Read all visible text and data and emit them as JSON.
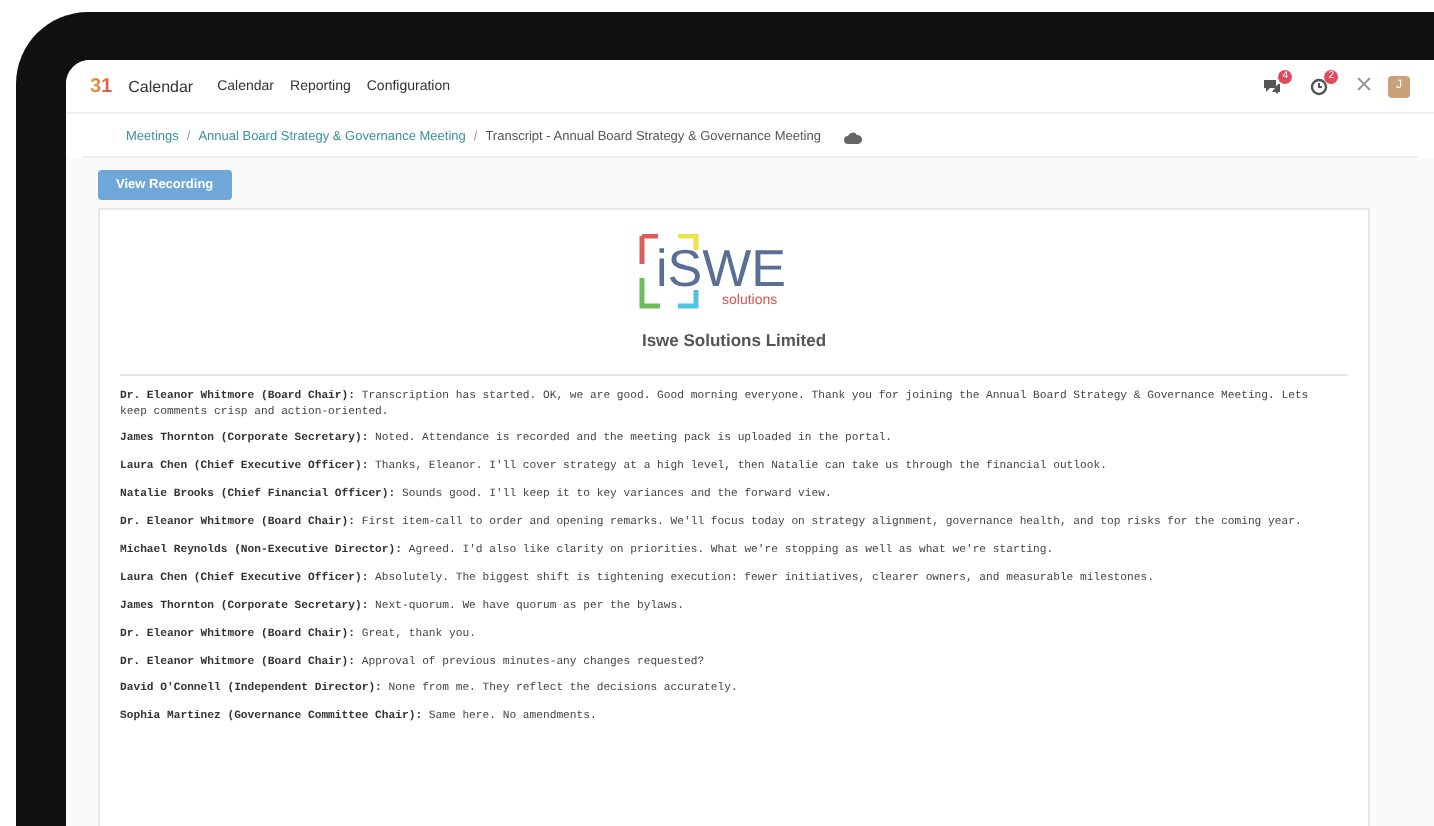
{
  "navbar": {
    "app_icon": "31",
    "app_name": "Calendar",
    "menu": [
      "Calendar",
      "Reporting",
      "Configuration"
    ],
    "messages_badge": "4",
    "activity_badge": "2",
    "avatar": "J"
  },
  "breadcrumb_separator": "/",
  "breadcrumb": [
    "Meetings",
    "Annual Board Strategy & Governance Meeting",
    "Transcript - Annual Board Strategy & Governance Meeting"
  ],
  "view_recording_button": "View Recording",
  "logo": {
    "mark": "iSWE",
    "tagline": "solutions"
  },
  "company": "Iswe Solutions Limited",
  "transcript": [
    {
      "speaker": "Dr. Eleanor Whitmore (Board Chair):",
      "text": "Transcription has started. OK, we are good. Good morning everyone. Thank you for joining the Annual Board Strategy & Governance Meeting. Lets keep comments crisp and action-oriented."
    },
    {
      "speaker": "James Thornton (Corporate Secretary):",
      "text": "Noted. Attendance is recorded and the meeting pack is uploaded in the portal."
    },
    {
      "speaker": "Laura Chen (Chief Executive Officer):",
      "text": "Thanks, Eleanor. I'll cover strategy at a high level, then Natalie can take us through the financial outlook."
    },
    {
      "speaker": "Natalie Brooks (Chief Financial Officer):",
      "text": "Sounds good. I'll keep it to key variances and the forward view."
    },
    {
      "speaker": "Dr. Eleanor Whitmore (Board Chair):",
      "text": "First item-call to order and opening remarks. We'll focus today on strategy alignment, governance health, and top risks for the coming year."
    },
    {
      "speaker": "Michael Reynolds (Non-Executive Director):",
      "text": "Agreed. I'd also like clarity on priorities. What we're stopping as well as what we're starting."
    },
    {
      "speaker": "Laura Chen (Chief Executive Officer):",
      "text": "Absolutely. The biggest shift is tightening execution: fewer initiatives, clearer owners, and measurable milestones."
    },
    {
      "speaker": "James Thornton (Corporate Secretary):",
      "text": "Next-quorum. We have quorum as per the bylaws."
    },
    {
      "speaker": "Dr. Eleanor Whitmore (Board Chair):",
      "text": "Great, thank you."
    },
    {
      "speaker": "Dr. Eleanor Whitmore (Board Chair):",
      "text": "Approval of previous minutes-any changes requested?"
    },
    {
      "speaker": "David O'Connell (Independent Director):",
      "text": "None from me. They reflect the decisions accurately."
    },
    {
      "speaker": "Sophia Martinez (Governance Committee Chair):",
      "text": "Same here. No amendments."
    }
  ]
}
